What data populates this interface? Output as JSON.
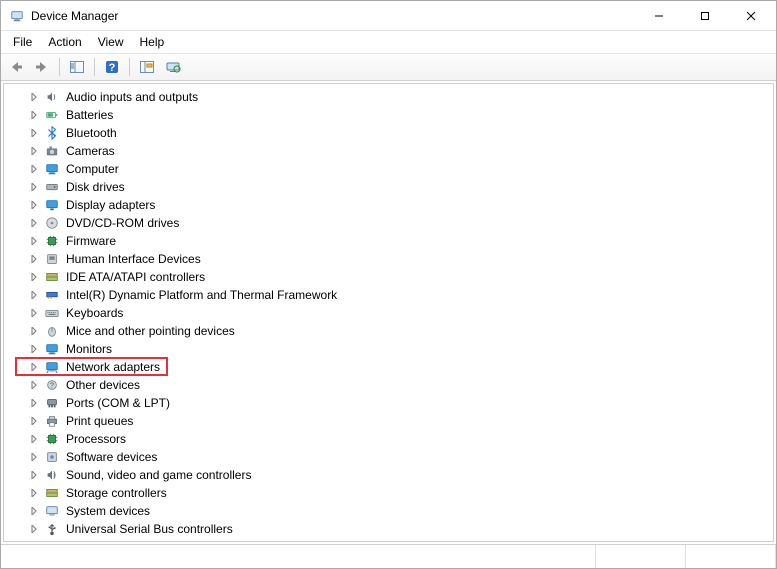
{
  "window": {
    "title": "Device Manager"
  },
  "menu": {
    "file": "File",
    "action": "Action",
    "view": "View",
    "help": "Help"
  },
  "categories": [
    {
      "id": "audio",
      "label": "Audio inputs and outputs",
      "icon": "speaker-icon"
    },
    {
      "id": "batteries",
      "label": "Batteries",
      "icon": "battery-icon"
    },
    {
      "id": "bluetooth",
      "label": "Bluetooth",
      "icon": "bluetooth-icon"
    },
    {
      "id": "cameras",
      "label": "Cameras",
      "icon": "camera-icon"
    },
    {
      "id": "computer",
      "label": "Computer",
      "icon": "computer-icon"
    },
    {
      "id": "disk",
      "label": "Disk drives",
      "icon": "disk-icon"
    },
    {
      "id": "display",
      "label": "Display adapters",
      "icon": "display-icon"
    },
    {
      "id": "dvd",
      "label": "DVD/CD-ROM drives",
      "icon": "optical-icon"
    },
    {
      "id": "firmware",
      "label": "Firmware",
      "icon": "chip-icon"
    },
    {
      "id": "hid",
      "label": "Human Interface Devices",
      "icon": "hid-icon"
    },
    {
      "id": "ide",
      "label": "IDE ATA/ATAPI controllers",
      "icon": "ide-icon"
    },
    {
      "id": "intel",
      "label": "Intel(R) Dynamic Platform and Thermal Framework",
      "icon": "pci-icon"
    },
    {
      "id": "keyboards",
      "label": "Keyboards",
      "icon": "keyboard-icon"
    },
    {
      "id": "mice",
      "label": "Mice and other pointing devices",
      "icon": "mouse-icon"
    },
    {
      "id": "monitors",
      "label": "Monitors",
      "icon": "monitor-icon"
    },
    {
      "id": "network",
      "label": "Network adapters",
      "icon": "network-icon",
      "highlight": true
    },
    {
      "id": "other",
      "label": "Other devices",
      "icon": "other-icon"
    },
    {
      "id": "ports",
      "label": "Ports (COM & LPT)",
      "icon": "port-icon"
    },
    {
      "id": "printq",
      "label": "Print queues",
      "icon": "printer-icon"
    },
    {
      "id": "processors",
      "label": "Processors",
      "icon": "cpu-icon"
    },
    {
      "id": "software",
      "label": "Software devices",
      "icon": "software-icon"
    },
    {
      "id": "sound",
      "label": "Sound, video and game controllers",
      "icon": "sound-icon"
    },
    {
      "id": "storage",
      "label": "Storage controllers",
      "icon": "storage-icon"
    },
    {
      "id": "system",
      "label": "System devices",
      "icon": "system-icon"
    },
    {
      "id": "usb",
      "label": "Universal Serial Bus controllers",
      "icon": "usb-icon"
    }
  ]
}
